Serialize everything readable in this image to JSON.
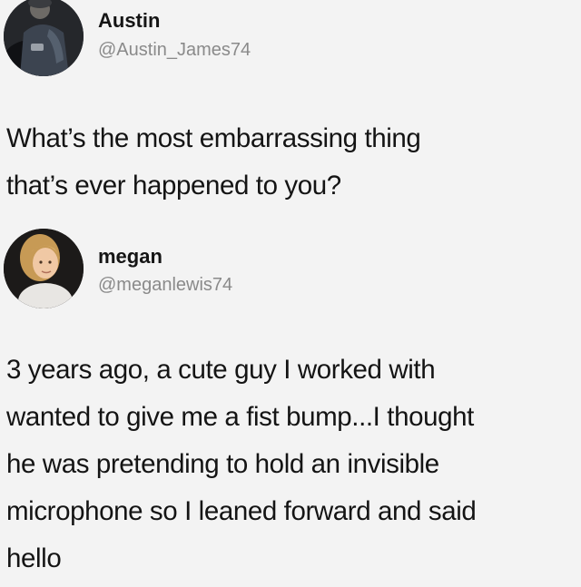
{
  "tweets": [
    {
      "name": "Austin",
      "handle": "@Austin_James74",
      "avatar_icon": "person-photo-avatar",
      "text_lines": [
        "What’s the most embarrassing thing",
        "that’s ever happened to you?"
      ]
    },
    {
      "name": "megan",
      "handle": "@meganlewis74",
      "avatar_icon": "person-photo-avatar",
      "text_lines": [
        "3 years ago, a cute guy I worked with",
        "wanted to give me a fist bump...I thought",
        "he was pretending to hold an invisible",
        "microphone so I leaned forward and said",
        "hello"
      ]
    }
  ]
}
